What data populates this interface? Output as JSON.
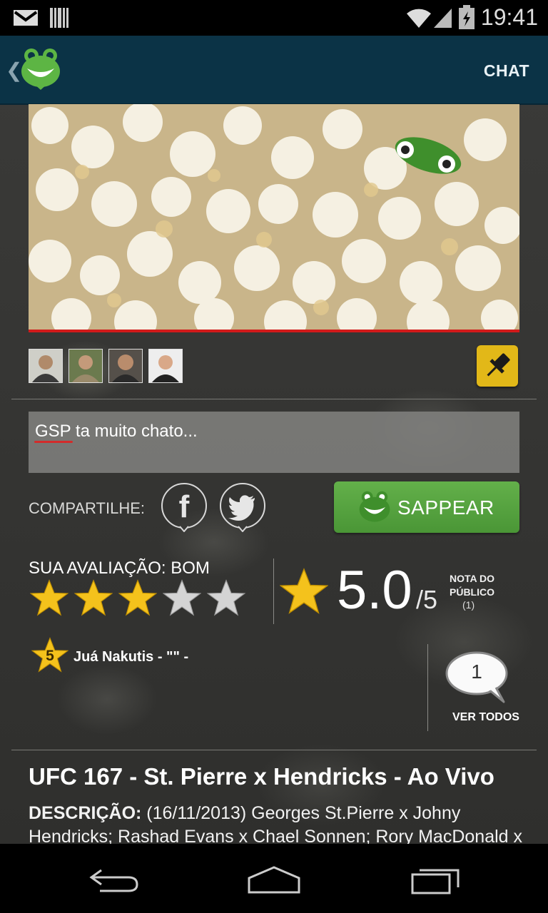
{
  "status_bar": {
    "time": "19:41",
    "icons": [
      "gmail-icon",
      "barcode-icon",
      "wifi-icon",
      "signal-icon",
      "battery-charging-icon"
    ]
  },
  "action_bar": {
    "logo": "frog-logo-icon",
    "chat_label": "CHAT"
  },
  "post": {
    "image": "popcorn-photo",
    "viewers": [
      "avatar-1",
      "avatar-2",
      "avatar-3",
      "avatar-4"
    ],
    "pin_icon": "pin-icon",
    "message": "GSP ta muito chato..."
  },
  "share": {
    "label": "COMPARTILHE:",
    "networks": [
      "facebook",
      "twitter"
    ],
    "sappear_label": "SAPPEAR"
  },
  "rating": {
    "user_label": "SUA AVALIAÇÃO: BOM",
    "user_stars": 3,
    "max_stars": 5,
    "public_score": "5.0",
    "public_max": "/5",
    "public_label": "NOTA DO PÚBLICO",
    "public_count": "(1)"
  },
  "review": {
    "stars": "5",
    "text": "Juá Nakutis - \"\" -",
    "comment_count": "1",
    "see_all": "VER TODOS"
  },
  "event": {
    "title": "UFC 167 - St. Pierre x Hendricks - Ao Vivo",
    "description_label": "DESCRIÇÃO:",
    "description": "(16/11/2013) Georges St.Pierre x Johny Hendricks; Rashad Evans x Chael Sonnen; Rory MacDonald x Robbie Lawler;"
  },
  "colors": {
    "action_bar": "#0b3346",
    "accent_green": "#5aa842",
    "pin_yellow": "#e2b818",
    "progress_red": "#d11a1a"
  }
}
